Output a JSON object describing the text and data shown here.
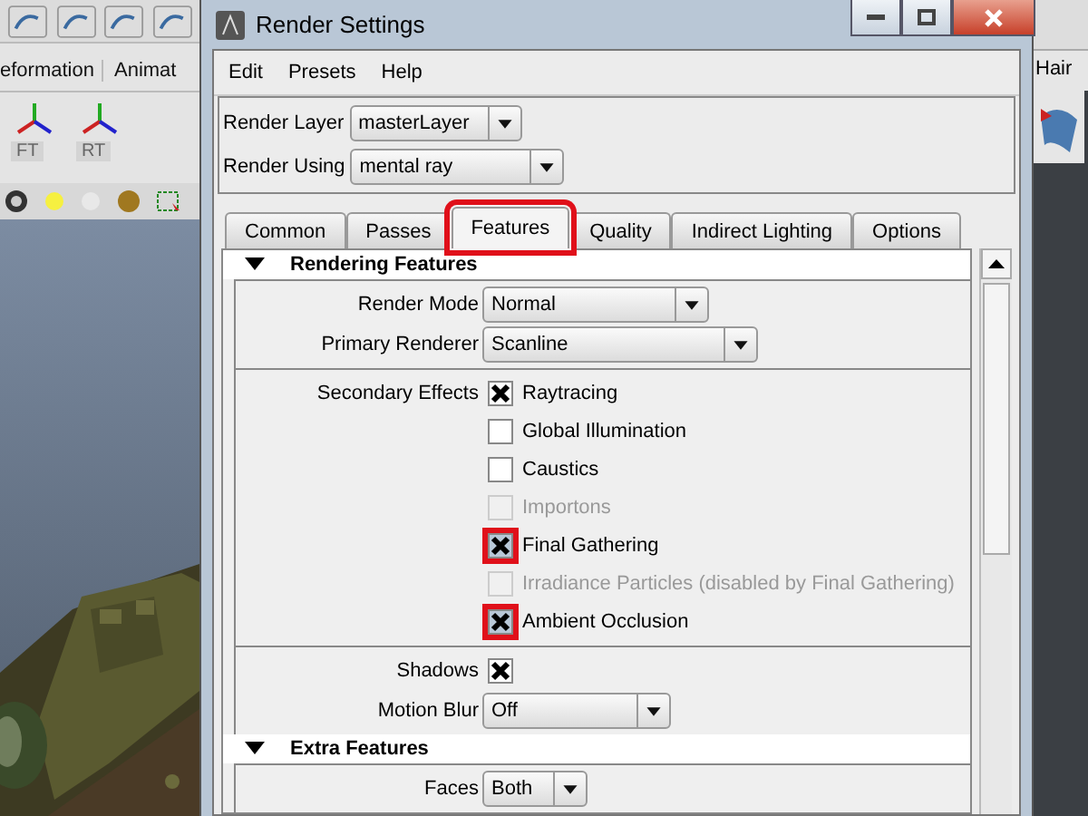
{
  "maya": {
    "menu_tabs": [
      "eformation",
      "Animat"
    ],
    "shelf_labels": [
      "FT",
      "RT"
    ],
    "right_tab": "Hair"
  },
  "window": {
    "title": "Render Settings",
    "menu": [
      "Edit",
      "Presets",
      "Help"
    ],
    "selectors": [
      {
        "label": "Render Layer",
        "value": "masterLayer"
      },
      {
        "label": "Render Using",
        "value": "mental ray"
      }
    ],
    "tabs": [
      {
        "label": "Common",
        "selected": false,
        "highlighted": false
      },
      {
        "label": "Passes",
        "selected": false,
        "highlighted": false
      },
      {
        "label": "Features",
        "selected": true,
        "highlighted": true
      },
      {
        "label": "Quality",
        "selected": false,
        "highlighted": false
      },
      {
        "label": "Indirect Lighting",
        "selected": false,
        "highlighted": false
      },
      {
        "label": "Options",
        "selected": false,
        "highlighted": false
      }
    ],
    "sections": [
      {
        "title": "Rendering Features",
        "expanded": true,
        "groups": [
          [
            {
              "kind": "dropdown",
              "label": "Render Mode",
              "value": "Normal"
            },
            {
              "kind": "dropdown",
              "label": "Primary Renderer",
              "value": "Scanline"
            }
          ],
          [
            {
              "kind": "checks",
              "label": "Secondary Effects",
              "options": [
                {
                  "label": "Raytracing",
                  "checked": true,
                  "disabled": false,
                  "highlighted": false
                },
                {
                  "label": "Global Illumination",
                  "checked": false,
                  "disabled": false,
                  "highlighted": false
                },
                {
                  "label": "Caustics",
                  "checked": false,
                  "disabled": false,
                  "highlighted": false
                },
                {
                  "label": "Importons",
                  "checked": false,
                  "disabled": true,
                  "highlighted": false
                },
                {
                  "label": "Final Gathering",
                  "checked": true,
                  "disabled": false,
                  "highlighted": true
                },
                {
                  "label": "Irradiance Particles (disabled by Final Gathering)",
                  "checked": false,
                  "disabled": true,
                  "highlighted": false
                },
                {
                  "label": "Ambient Occlusion",
                  "checked": true,
                  "disabled": false,
                  "highlighted": true
                }
              ]
            }
          ],
          [
            {
              "kind": "checkbox",
              "label": "Shadows",
              "checked": true
            },
            {
              "kind": "dropdown",
              "label": "Motion Blur",
              "value": "Off"
            }
          ]
        ]
      },
      {
        "title": "Extra Features",
        "expanded": true,
        "groups": [
          [
            {
              "kind": "dropdown",
              "label": "Faces",
              "value": "Both"
            }
          ]
        ]
      }
    ]
  }
}
